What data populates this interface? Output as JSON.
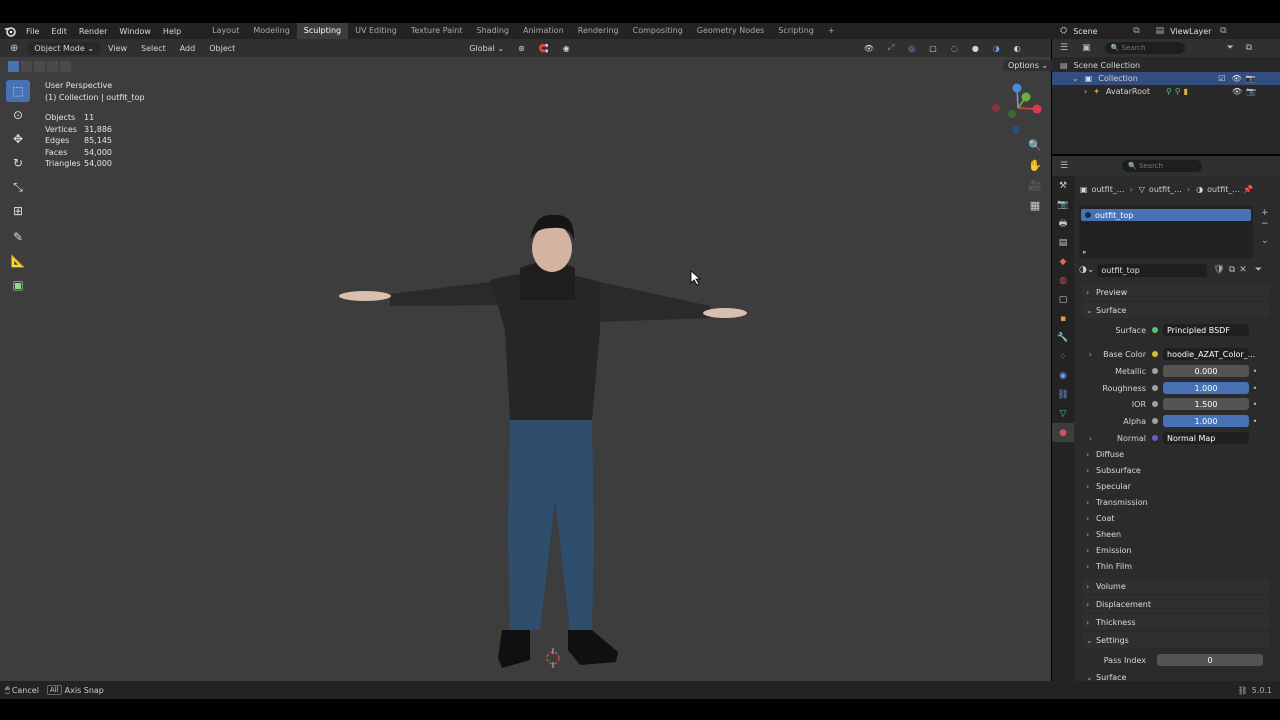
{
  "menu": {
    "items": [
      "File",
      "Edit",
      "Render",
      "Window",
      "Help"
    ],
    "workspaces": [
      "Layout",
      "Modeling",
      "Sculpting",
      "UV Editing",
      "Texture Paint",
      "Shading",
      "Animation",
      "Rendering",
      "Compositing",
      "Geometry Nodes",
      "Scripting"
    ],
    "active_workspace": "Sculpting",
    "add_tab": "+",
    "scene": "Scene",
    "view_layer": "ViewLayer"
  },
  "viewport": {
    "mode": "Object Mode",
    "menus": [
      "View",
      "Select",
      "Add",
      "Object"
    ],
    "orientation": "Global",
    "options": "Options",
    "perspective": "User Perspective",
    "collection_line": "(1) Collection | outfit_top",
    "stats": [
      {
        "label": "Objects",
        "value": "11"
      },
      {
        "label": "Vertices",
        "value": "31,886"
      },
      {
        "label": "Edges",
        "value": "85,145"
      },
      {
        "label": "Faces",
        "value": "54,000"
      },
      {
        "label": "Triangles",
        "value": "54,000"
      }
    ],
    "background_color": "#3d3d3d"
  },
  "outliner": {
    "search_placeholder": "Search",
    "scene_collection": "Scene Collection",
    "collection": "Collection",
    "avatar_root": "AvatarRoot"
  },
  "properties": {
    "search_placeholder": "Search",
    "breadcrumb": [
      "outfit_...",
      "outfit_...",
      "outfit_..."
    ],
    "slot_name": "outfit_top",
    "material_name": "outfit_top",
    "panels": {
      "preview": "Preview",
      "surface": "Surface",
      "volume": "Volume",
      "displacement": "Displacement",
      "thickness": "Thickness",
      "settings": "Settings"
    },
    "surface_fields": {
      "surface_label": "Surface",
      "surface_value": "Principled BSDF",
      "base_color_label": "Base Color",
      "base_color_value": "hoodie_AZAT_Color_...",
      "metallic_label": "Metallic",
      "metallic_value": "0.000",
      "roughness_label": "Roughness",
      "roughness_value": "1.000",
      "ior_label": "IOR",
      "ior_value": "1.500",
      "alpha_label": "Alpha",
      "alpha_value": "1.000",
      "normal_label": "Normal",
      "normal_value": "Normal Map"
    },
    "subpanels": [
      "Diffuse",
      "Subsurface",
      "Specular",
      "Transmission",
      "Coat",
      "Sheen",
      "Emission",
      "Thin Film"
    ],
    "pass_index_label": "Pass Index",
    "pass_index_value": "0",
    "surface_tail": "Surface",
    "accent_color": "#4772b3"
  },
  "status": {
    "cancel": "Cancel",
    "all": "All",
    "axis_snap": "Axis Snap",
    "version": "5.0.1"
  }
}
